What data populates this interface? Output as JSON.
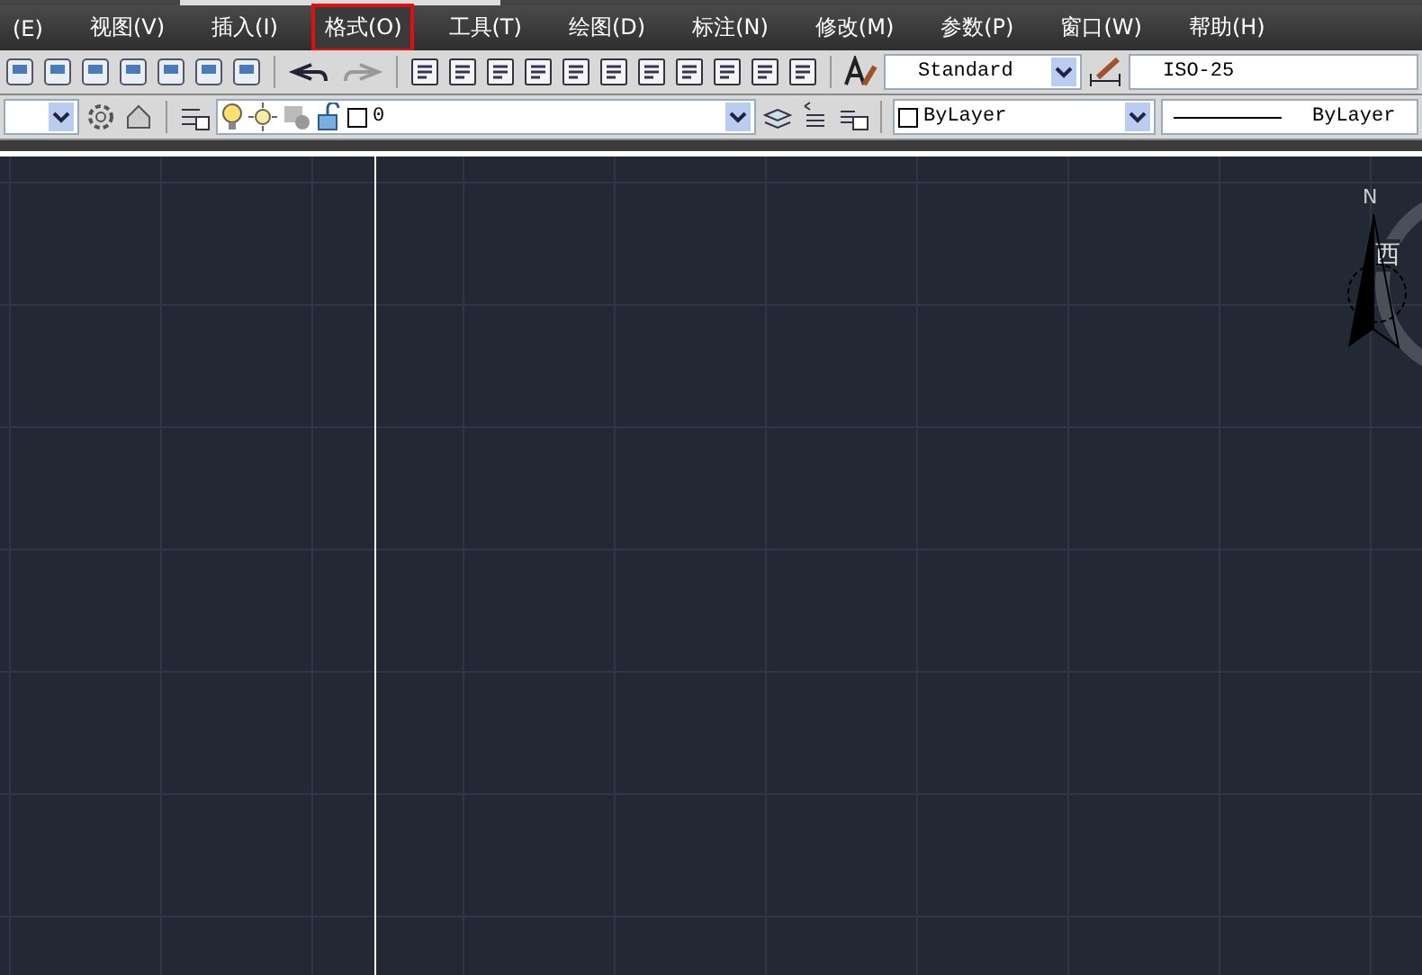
{
  "menu": [
    {
      "label": "(E)",
      "selected": false
    },
    {
      "label": "视图(V)",
      "selected": false
    },
    {
      "label": "插入(I)",
      "selected": false
    },
    {
      "label": "格式(O)",
      "selected": true
    },
    {
      "label": "工具(T)",
      "selected": false
    },
    {
      "label": "绘图(D)",
      "selected": false
    },
    {
      "label": "标注(N)",
      "selected": false
    },
    {
      "label": "修改(M)",
      "selected": false
    },
    {
      "label": "参数(P)",
      "selected": false
    },
    {
      "label": "窗口(W)",
      "selected": false
    },
    {
      "label": "帮助(H)",
      "selected": false
    }
  ],
  "toolbar": {
    "text_style": "Standard",
    "dim_style": "ISO-25"
  },
  "layers": {
    "layer": "0",
    "color_setting": "ByLayer",
    "linetype": "ByLayer"
  },
  "compass": {
    "north": "N",
    "west": "西"
  }
}
